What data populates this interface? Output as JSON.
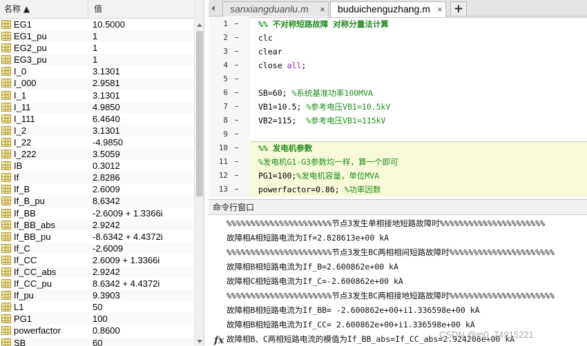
{
  "workspace": {
    "headers": {
      "name": "名称 ▲",
      "value": "值"
    },
    "rows": [
      {
        "name": "EG1",
        "value": "10.5000"
      },
      {
        "name": "EG1_pu",
        "value": "1"
      },
      {
        "name": "EG2_pu",
        "value": "1"
      },
      {
        "name": "EG3_pu",
        "value": "1"
      },
      {
        "name": "I_0",
        "value": "3.1301"
      },
      {
        "name": "I_000",
        "value": "2.9581"
      },
      {
        "name": "I_1",
        "value": "3.1301"
      },
      {
        "name": "I_11",
        "value": "4.9850"
      },
      {
        "name": "I_111",
        "value": "6.4640"
      },
      {
        "name": "I_2",
        "value": "3.1301"
      },
      {
        "name": "I_22",
        "value": "-4.9850"
      },
      {
        "name": "I_222",
        "value": "3.5059"
      },
      {
        "name": "IB",
        "value": "0.3012"
      },
      {
        "name": "If",
        "value": "2.8286"
      },
      {
        "name": "If_B",
        "value": "2.6009"
      },
      {
        "name": "If_B_pu",
        "value": "8.6342"
      },
      {
        "name": "If_BB",
        "value": "-2.6009 + 1.3366i"
      },
      {
        "name": "If_BB_abs",
        "value": "2.9242"
      },
      {
        "name": "If_BB_pu",
        "value": "-8.6342 + 4.4372i"
      },
      {
        "name": "If_C",
        "value": "-2.6009"
      },
      {
        "name": "If_CC",
        "value": "2.6009 + 1.3366i"
      },
      {
        "name": "If_CC_abs",
        "value": "2.9242"
      },
      {
        "name": "If_CC_pu",
        "value": "8.6342 + 4.4372i"
      },
      {
        "name": "If_pu",
        "value": "9.3903"
      },
      {
        "name": "L1",
        "value": "50"
      },
      {
        "name": "PG1",
        "value": "100"
      },
      {
        "name": "powerfactor",
        "value": "0.8600"
      },
      {
        "name": "SB",
        "value": "60"
      }
    ]
  },
  "editor": {
    "tabs": [
      {
        "label": "sanxiangduanlu.m",
        "close": "×"
      },
      {
        "label": "buduichenguzhang.m",
        "close": "×"
      }
    ],
    "add_tab": "+",
    "lines": [
      {
        "num": "1",
        "text": "%% 不对称短路故障 对称分量法计算",
        "kind": "cell"
      },
      {
        "num": "2",
        "text": "clc",
        "kind": "code"
      },
      {
        "num": "3",
        "text": "clear",
        "kind": "code"
      },
      {
        "num": "4",
        "text": "close all;",
        "kind": "close"
      },
      {
        "num": "5",
        "text": "",
        "kind": "blank"
      },
      {
        "num": "6",
        "text": "SB=60; %系统基准功率100MVA",
        "kind": "code-cmt",
        "code": "SB=60; ",
        "cmt": "%系统基准功率100MVA"
      },
      {
        "num": "7",
        "text": "VB1=10.5; %参考电压VB1=10.5kV",
        "kind": "code-cmt",
        "code": "VB1=10.5; ",
        "cmt": "%参考电压VB1=10.5kV"
      },
      {
        "num": "8",
        "text": "VB2=115;  %参考电压VB1=115kV",
        "kind": "code-cmt",
        "code": "VB2=115;  ",
        "cmt": "%参考电压VB1=115kV"
      },
      {
        "num": "9",
        "text": "",
        "kind": "blank"
      },
      {
        "num": "10",
        "text": "%% 发电机参数",
        "kind": "cell"
      },
      {
        "num": "11",
        "text": "%发电机G1-G3参数均一样，算一个即可",
        "kind": "comment"
      },
      {
        "num": "12",
        "text": "PG1=100;%发电机容量，单位MVA",
        "kind": "code-cmt",
        "code": "PG1=100;",
        "cmt": "%发电机容量，单位MVA"
      },
      {
        "num": "13",
        "text": "powerfactor=0.86; %功率因数",
        "kind": "code-cmt",
        "code": "powerfactor=0.86; ",
        "cmt": "%功率因数"
      }
    ],
    "close_keyword": "close",
    "close_arg": "all",
    "close_end": ";"
  },
  "command_window": {
    "title": "命令行窗口",
    "lines": [
      "%%%%%%%%%%%%%%%%%%%%%%节点3发生单相接地短路故障时%%%%%%%%%%%%%%%%%%%%%%",
      "故障相A相短路电流为If=2.828613e+00 kA",
      "%%%%%%%%%%%%%%%%%%%%%%节点3发生BC两相相间短路故障时%%%%%%%%%%%%%%%%%%%%%%",
      "故障相B相短路电流为If_B=2.600862e+00 kA",
      "故障相C相短路电流为If_C=-2.600862e+00 kA",
      "%%%%%%%%%%%%%%%%%%%%%%节点3发生BC两相接地短路故障时%%%%%%%%%%%%%%%%%%%%%%",
      "故障相B相短路电流为If_BB= -2.600862e+00+i1.336598e+00 kA",
      "故障相B相短路电流为If_CC= 2.600862e+00+i1.336598e+00 kA",
      "故障相B、C两相短路电流的模值为If_BB_abs=If_CC_abs=2.924208e+00 kA"
    ],
    "prompt_icon": "fx"
  },
  "watermark": "CSDN @m0_74915221"
}
